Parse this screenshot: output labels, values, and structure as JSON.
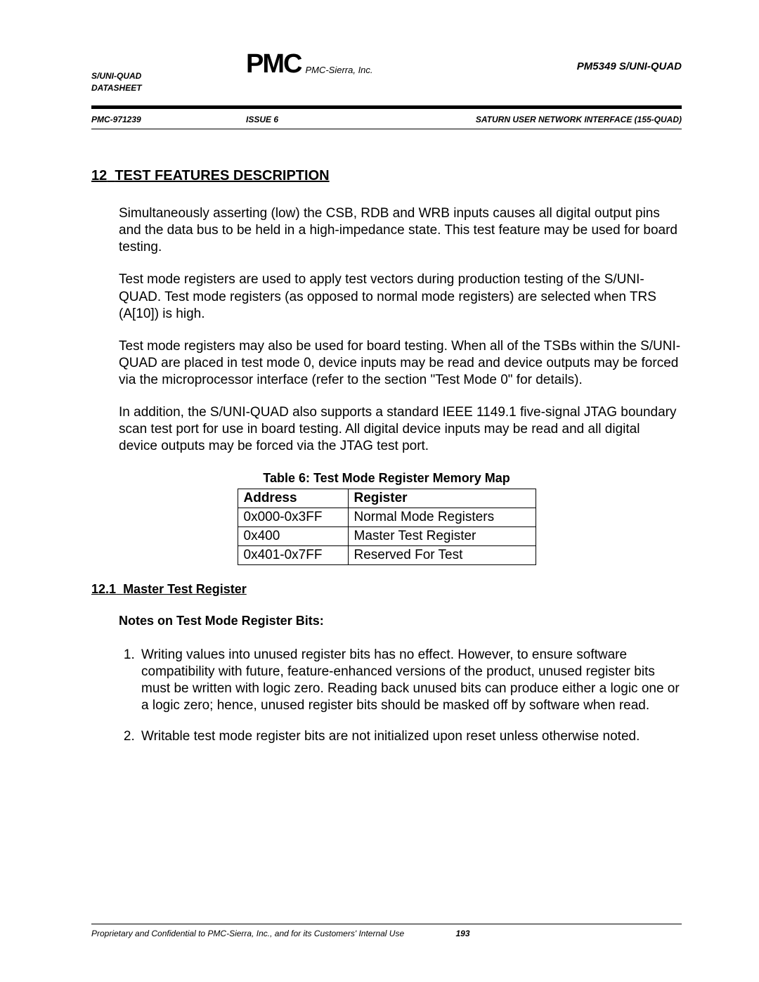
{
  "header": {
    "left_line1": "S/UNI-QUAD",
    "left_line2": "DATASHEET",
    "logo_text": "PMC",
    "logo_company": "PMC-Sierra, Inc.",
    "right": "PM5349 S/UNI-QUAD"
  },
  "subheader": {
    "left": "PMC-971239",
    "center": "ISSUE 6",
    "right": "SATURN USER NETWORK INTERFACE (155-QUAD)"
  },
  "section": {
    "number": "12",
    "title": "TEST FEATURES DESCRIPTION",
    "paragraphs": [
      "Simultaneously asserting (low) the CSB, RDB and WRB inputs causes all digital output pins and the data bus to be held in a high-impedance state.  This test feature may be used for board testing.",
      "Test mode registers are used to apply test vectors during production testing of the S/UNI-QUAD.  Test mode registers (as opposed to normal mode registers) are selected when TRS (A[10]) is high.",
      "Test mode registers may also be used for board testing.  When all of the TSBs within the S/UNI-QUAD are placed in test mode 0, device inputs may be read and device outputs may be forced via the microprocessor interface (refer to the section \"Test Mode 0\" for details).",
      "In addition, the S/UNI-QUAD also supports a standard IEEE 1149.1 five-signal JTAG boundary scan test port for use in board testing.  All digital device inputs may be read and all digital device outputs may be forced via the JTAG test port."
    ]
  },
  "table": {
    "caption": "Table 6: Test Mode Register Memory Map",
    "headers": [
      "Address",
      "Register"
    ],
    "rows": [
      [
        "0x000-0x3FF",
        "Normal Mode Registers"
      ],
      [
        "0x400",
        "Master Test Register"
      ],
      [
        "0x401-0x7FF",
        "Reserved For Test"
      ]
    ]
  },
  "subsection": {
    "number": "12.1",
    "title": "Master Test Register",
    "notes_heading": "Notes on Test Mode Register Bits:",
    "notes": [
      "Writing values into unused register bits has no effect.  However, to ensure software compatibility with future, feature-enhanced versions of the product, unused register bits must be written with logic zero.  Reading back unused bits can produce either a logic one or a logic zero; hence, unused register bits should be masked off by software when read.",
      "Writable test mode register bits are not initialized upon reset unless otherwise noted."
    ]
  },
  "footer": {
    "text": "Proprietary and Confidential to PMC-Sierra, Inc., and for its Customers' Internal Use",
    "page": "193"
  }
}
